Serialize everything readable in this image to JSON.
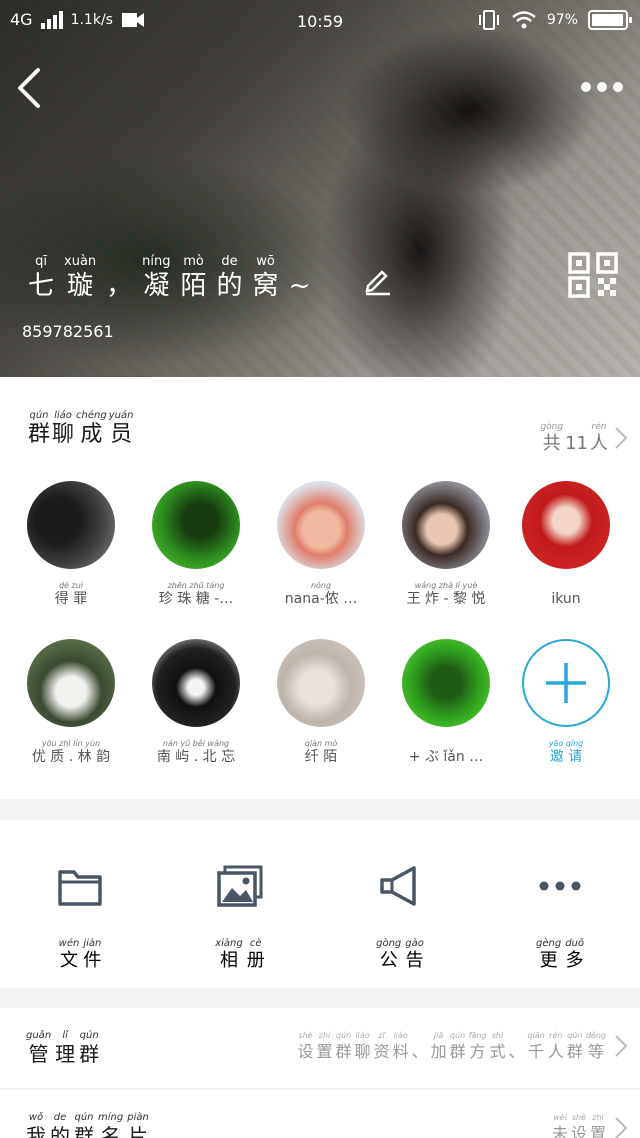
{
  "status": {
    "network": "4G",
    "speed": "1.1k/s",
    "time": "10:59",
    "battery": "97%"
  },
  "header": {
    "title_pinyin": [
      "qī",
      "xuàn",
      "",
      "níng",
      "mò",
      "de",
      "wō",
      ""
    ],
    "title_chars": [
      "七",
      "璇",
      "，",
      "凝",
      "陌",
      "的",
      "窝",
      "~"
    ],
    "group_id": "859782561"
  },
  "members_section": {
    "title": [
      {
        "py": "qún",
        "hz": "群"
      },
      {
        "py": "liáo",
        "hz": "聊"
      },
      {
        "py": "chéng",
        "hz": "成"
      },
      {
        "py": "yuán",
        "hz": "员"
      }
    ],
    "count": [
      {
        "py": "gòng",
        "hz": "共"
      },
      {
        "py": "",
        "hz": "11"
      },
      {
        "py": "rén",
        "hz": "人"
      }
    ],
    "members": [
      {
        "py": "dé  zuì",
        "name": "得 罪"
      },
      {
        "py": "zhēn zhū táng",
        "name": "珍 珠 糖 -…"
      },
      {
        "py": "nóng",
        "name": "nana-侬 …"
      },
      {
        "py": "wáng zhà   lí  yuè",
        "name": "王 炸 - 黎 悦"
      },
      {
        "py": "",
        "name": "ikun"
      },
      {
        "py": "yōu  zhì   lín  yùn",
        "name": "优 质 . 林 韵"
      },
      {
        "py": "nán  yǔ   běi wàng",
        "name": "南 屿 . 北 忘"
      },
      {
        "py": "qiàn  mò",
        "name": "纤 陌"
      },
      {
        "py": "",
        "name": "+ ぶ ǐǎn …"
      },
      {
        "py": "yāo  qǐng",
        "name": "邀 请"
      }
    ],
    "colors": {
      "accent": "#28a7d8"
    }
  },
  "actions": [
    {
      "icon": "folder-icon",
      "label": [
        {
          "py": "wén",
          "hz": "文"
        },
        {
          "py": "jiàn",
          "hz": "件"
        }
      ]
    },
    {
      "icon": "album-icon",
      "label": [
        {
          "py": "xiàng",
          "hz": "相"
        },
        {
          "py": "cè",
          "hz": "册"
        }
      ]
    },
    {
      "icon": "megaphone-icon",
      "label": [
        {
          "py": "gòng",
          "hz": "公"
        },
        {
          "py": "gào",
          "hz": "告"
        }
      ]
    },
    {
      "icon": "more-dots-icon",
      "label": [
        {
          "py": "gèng",
          "hz": "更"
        },
        {
          "py": "duō",
          "hz": "多"
        }
      ]
    }
  ],
  "rows": {
    "manage": {
      "title": [
        {
          "py": "guǎn",
          "hz": "管"
        },
        {
          "py": "lǐ",
          "hz": "理"
        },
        {
          "py": "qún",
          "hz": "群"
        }
      ],
      "detail": [
        {
          "py": "shè",
          "hz": "设"
        },
        {
          "py": "zhì",
          "hz": "置"
        },
        {
          "py": "qún",
          "hz": "群"
        },
        {
          "py": "liáo",
          "hz": "聊"
        },
        {
          "py": "zī",
          "hz": "资"
        },
        {
          "py": "liào",
          "hz": "料"
        },
        {
          "py": "",
          "hz": "、"
        },
        {
          "py": "jiā",
          "hz": "加"
        },
        {
          "py": "qún",
          "hz": "群"
        },
        {
          "py": "fāng",
          "hz": "方"
        },
        {
          "py": "shì",
          "hz": "式"
        },
        {
          "py": "",
          "hz": "、"
        },
        {
          "py": "qiān",
          "hz": "千"
        },
        {
          "py": "rén",
          "hz": "人"
        },
        {
          "py": "qún",
          "hz": "群"
        },
        {
          "py": "děng",
          "hz": "等"
        }
      ]
    },
    "nickname": {
      "title": [
        {
          "py": "wǒ",
          "hz": "我"
        },
        {
          "py": "de",
          "hz": "的"
        },
        {
          "py": "qún",
          "hz": "群"
        },
        {
          "py": "míng",
          "hz": "名"
        },
        {
          "py": "piàn",
          "hz": "片"
        }
      ],
      "detail": [
        {
          "py": "wèi",
          "hz": "未"
        },
        {
          "py": "shè",
          "hz": "设"
        },
        {
          "py": "zhì",
          "hz": "置"
        }
      ]
    }
  }
}
